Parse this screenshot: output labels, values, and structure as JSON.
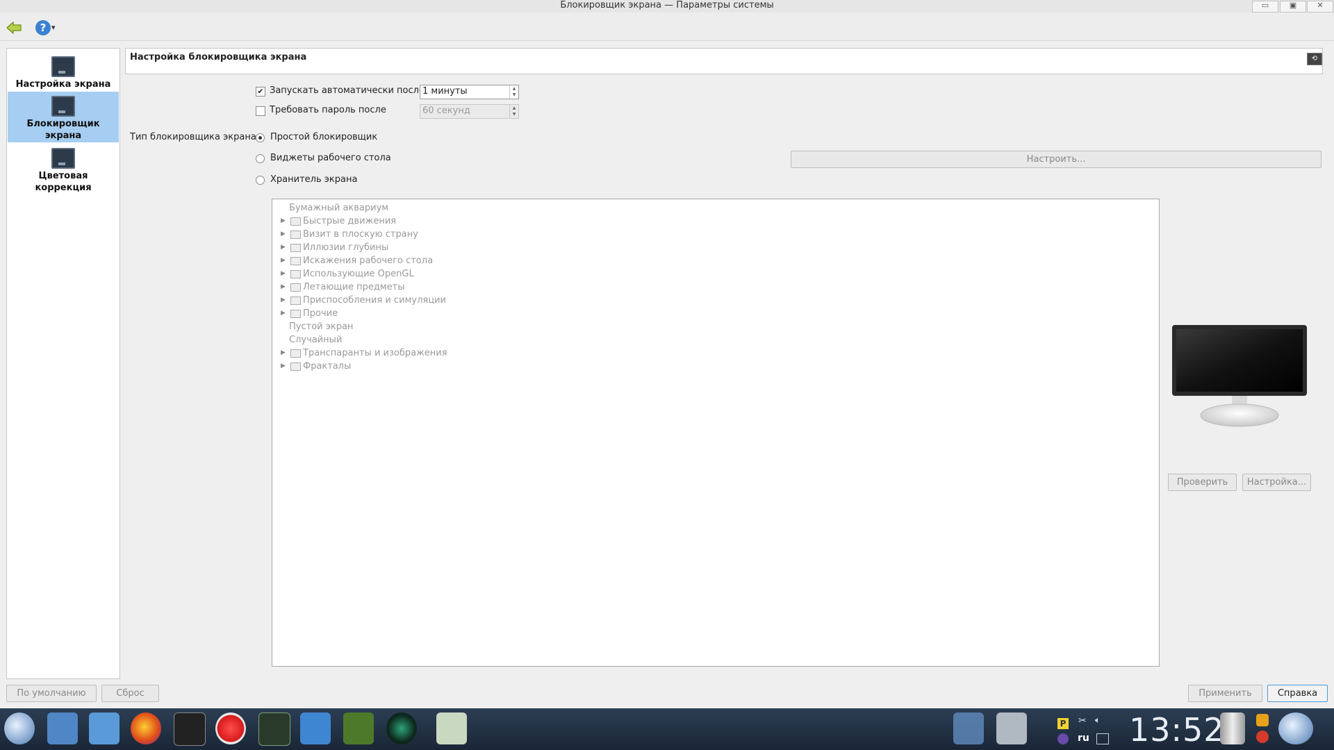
{
  "window": {
    "title": "Блокировщик экрана — Параметры системы",
    "buttons": {
      "minimize": "▭",
      "maximize": "▣",
      "close": "✕"
    }
  },
  "toolbar": {
    "back_icon": "back-arrow-icon",
    "help_glyph": "?",
    "help_dropdown": "▾"
  },
  "sidebar": {
    "items": [
      {
        "label": "Настройка экрана",
        "icon": "display-icon",
        "active": false
      },
      {
        "label": "Блокировщик экрана",
        "icon": "screenlocker-icon",
        "active": true
      },
      {
        "label": "Цветовая коррекция",
        "icon": "color-correction-icon",
        "active": false
      }
    ]
  },
  "header": {
    "title": "Настройка блокировщика экрана"
  },
  "options": {
    "auto_start_label": "Запускать автоматически после",
    "auto_start_checked": true,
    "auto_start_value": "1 минуты",
    "password_label": "Требовать пароль после",
    "password_checked": false,
    "password_value": "60 секунд"
  },
  "locker_type": {
    "label": "Тип блокировщика экрана:",
    "simple": "Простой блокировщик",
    "widgets": "Виджеты рабочего стола",
    "screensaver": "Хранитель экрана",
    "configure_button": "Настроить..."
  },
  "tree": {
    "items": [
      {
        "label": "Бумажный аквариум",
        "expandable": false
      },
      {
        "label": "Быстрые движения",
        "expandable": true
      },
      {
        "label": "Визит в плоскую страну",
        "expandable": true
      },
      {
        "label": "Иллюзии глубины",
        "expandable": true
      },
      {
        "label": "Искажения рабочего стола",
        "expandable": true
      },
      {
        "label": "Использующие OpenGL",
        "expandable": true
      },
      {
        "label": "Летающие предметы",
        "expandable": true
      },
      {
        "label": "Приспособления и симуляции",
        "expandable": true
      },
      {
        "label": "Прочие",
        "expandable": true
      },
      {
        "label": "Пустой экран",
        "expandable": false
      },
      {
        "label": "Случайный",
        "expandable": false
      },
      {
        "label": "Транспаранты и изображения",
        "expandable": true
      },
      {
        "label": "Фракталы",
        "expandable": true
      }
    ]
  },
  "preview": {
    "test_button": "Проверить",
    "setup_button": "Настройка..."
  },
  "footer": {
    "defaults": "По умолчанию",
    "reset": "Сброс",
    "apply": "Применить",
    "help": "Справка"
  },
  "taskbar": {
    "clock": "13:52",
    "keyboard_layout": "ru",
    "colors": {
      "background": "#1f2d40"
    }
  }
}
